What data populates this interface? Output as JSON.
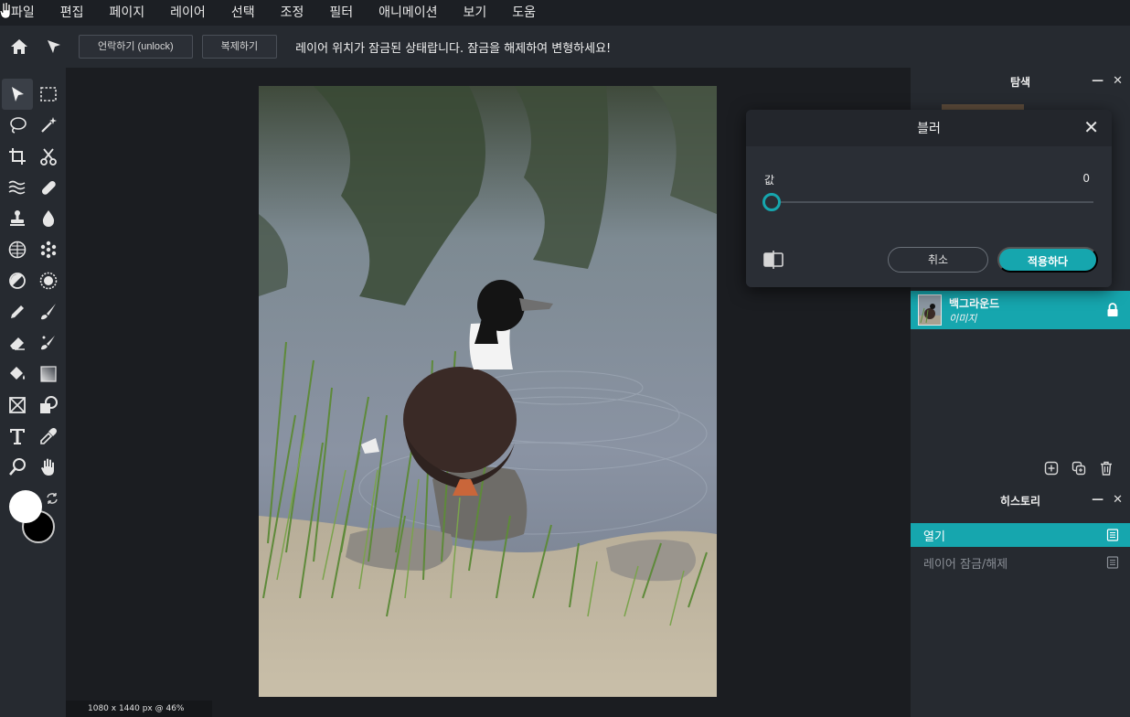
{
  "menu": {
    "items": [
      "파일",
      "편집",
      "페이지",
      "레이어",
      "선택",
      "조정",
      "필터",
      "애니메이션",
      "보기",
      "도움"
    ]
  },
  "options": {
    "unlock_label": "언락하기 (unlock)",
    "duplicate_label": "복제하기",
    "message": "레이어 위치가 잠금된 상태랍니다. 잠금을 해제하여 변형하세요!"
  },
  "status": {
    "text": "1080 x 1440 px @ 46%"
  },
  "panels": {
    "navigator_title": "탐색",
    "layer": {
      "name": "백그라운드",
      "type": "이미지"
    },
    "history_title": "히스토리",
    "history_items": [
      "열기",
      "레이어 잠금/해제"
    ]
  },
  "dialog": {
    "title": "블러",
    "value_label": "값",
    "value": "0",
    "slider_fraction": 0,
    "cancel_label": "취소",
    "apply_label": "적용하다"
  },
  "colors": {
    "accent": "#16a6ae",
    "foreground": "#ffffff",
    "background": "#000000"
  }
}
